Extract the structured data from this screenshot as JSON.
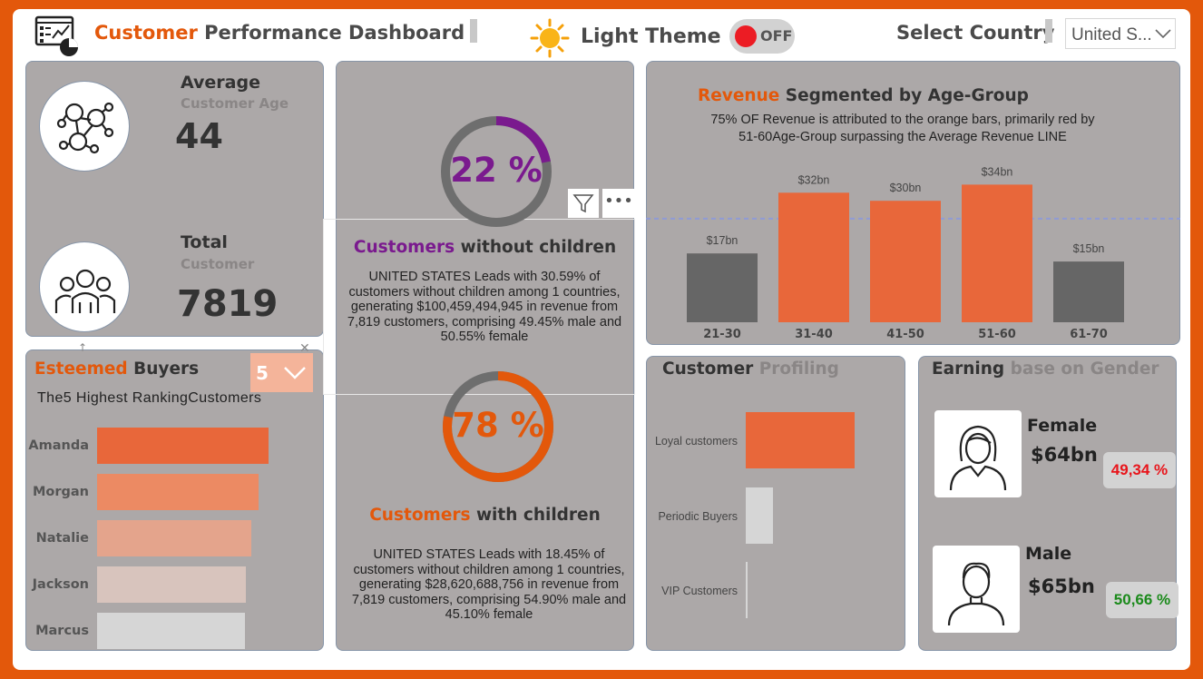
{
  "header": {
    "title_part1": "Customer",
    "title_part2": "Performance Dashboard",
    "theme_label": "Light Theme",
    "toggle_text": "OFF",
    "country_label": "Select Country",
    "country_value": "United S..."
  },
  "kpis": {
    "age_label": "Average",
    "age_sub": "Customer Age",
    "age_value": "44",
    "total_label": "Total",
    "total_sub": "Customer",
    "total_value": "7819"
  },
  "donuts": {
    "without": {
      "percent": 22,
      "label": "22 %",
      "title_part1": "Customers",
      "title_part2": "without children",
      "text": "UNITED STATES Leads with 30.59% of customers without children among 1 countries, generating $100,459,494,945 in revenue from 7,819 customers, comprising 49.45% male and 50.55% female"
    },
    "with": {
      "percent": 78,
      "label": "78 %",
      "title_part1": "Customers",
      "title_part2": "with children",
      "text": "UNITED STATES Leads with 18.45% of customers without children among 1 countries, generating $28,620,688,756 in revenue from 7,819 customers, comprising 54.90% male and 45.10% female"
    }
  },
  "buyers": {
    "title_part1": "Esteemed",
    "title_part2": "Buyers",
    "subtitle": "The5 Highest RankingCustomers",
    "dropdown_value": "5",
    "names": [
      "Amanda",
      "Morgan",
      "Natalie",
      "Jackson",
      "Marcus"
    ],
    "values": [
      100,
      94,
      90,
      87,
      86
    ],
    "colors": [
      "#e8673a",
      "#ec8a63",
      "#e4a48c",
      "#d8c4bd",
      "#d6d6d6"
    ]
  },
  "chart_data": {
    "type": "bar",
    "title_part1": "Revenue",
    "title_part2": "Segmented by Age-Group",
    "subtitle_line1": "75% OF Revenue is attributed to the orange bars, primarily red by",
    "subtitle_line2": "51-60Age-Group surpassing the Average Revenue LINE",
    "categories": [
      "21-30",
      "31-40",
      "41-50",
      "51-60",
      "61-70"
    ],
    "values": [
      17,
      32,
      30,
      34,
      15
    ],
    "labels": [
      "$17bn",
      "$32bn",
      "$30bn",
      "$34bn",
      "$15bn"
    ],
    "average": 25.6,
    "ylim": [
      0,
      37
    ],
    "colors": [
      "#666666",
      "#e8673a",
      "#e8673a",
      "#e8673a",
      "#666666"
    ]
  },
  "profiling": {
    "title_part1": "Customer",
    "title_part2": "Profiling",
    "categories": [
      "Loyal customers",
      "Periodic Buyers",
      "VIP Customers"
    ],
    "values": [
      100,
      25,
      2
    ]
  },
  "gender": {
    "title_part1": "Earning",
    "title_part2": "base on Gender",
    "female_label": "Female",
    "female_value": "$64bn",
    "female_pct": "49,34 %",
    "male_label": "Male",
    "male_value": "$65bn",
    "male_pct": "50,66 %"
  },
  "colors": {
    "accent": "#e3580b",
    "purple": "#7a1a8e",
    "card_bg": "#aca8a8",
    "neg": "#e8151b",
    "pos": "#1b8a1b"
  }
}
